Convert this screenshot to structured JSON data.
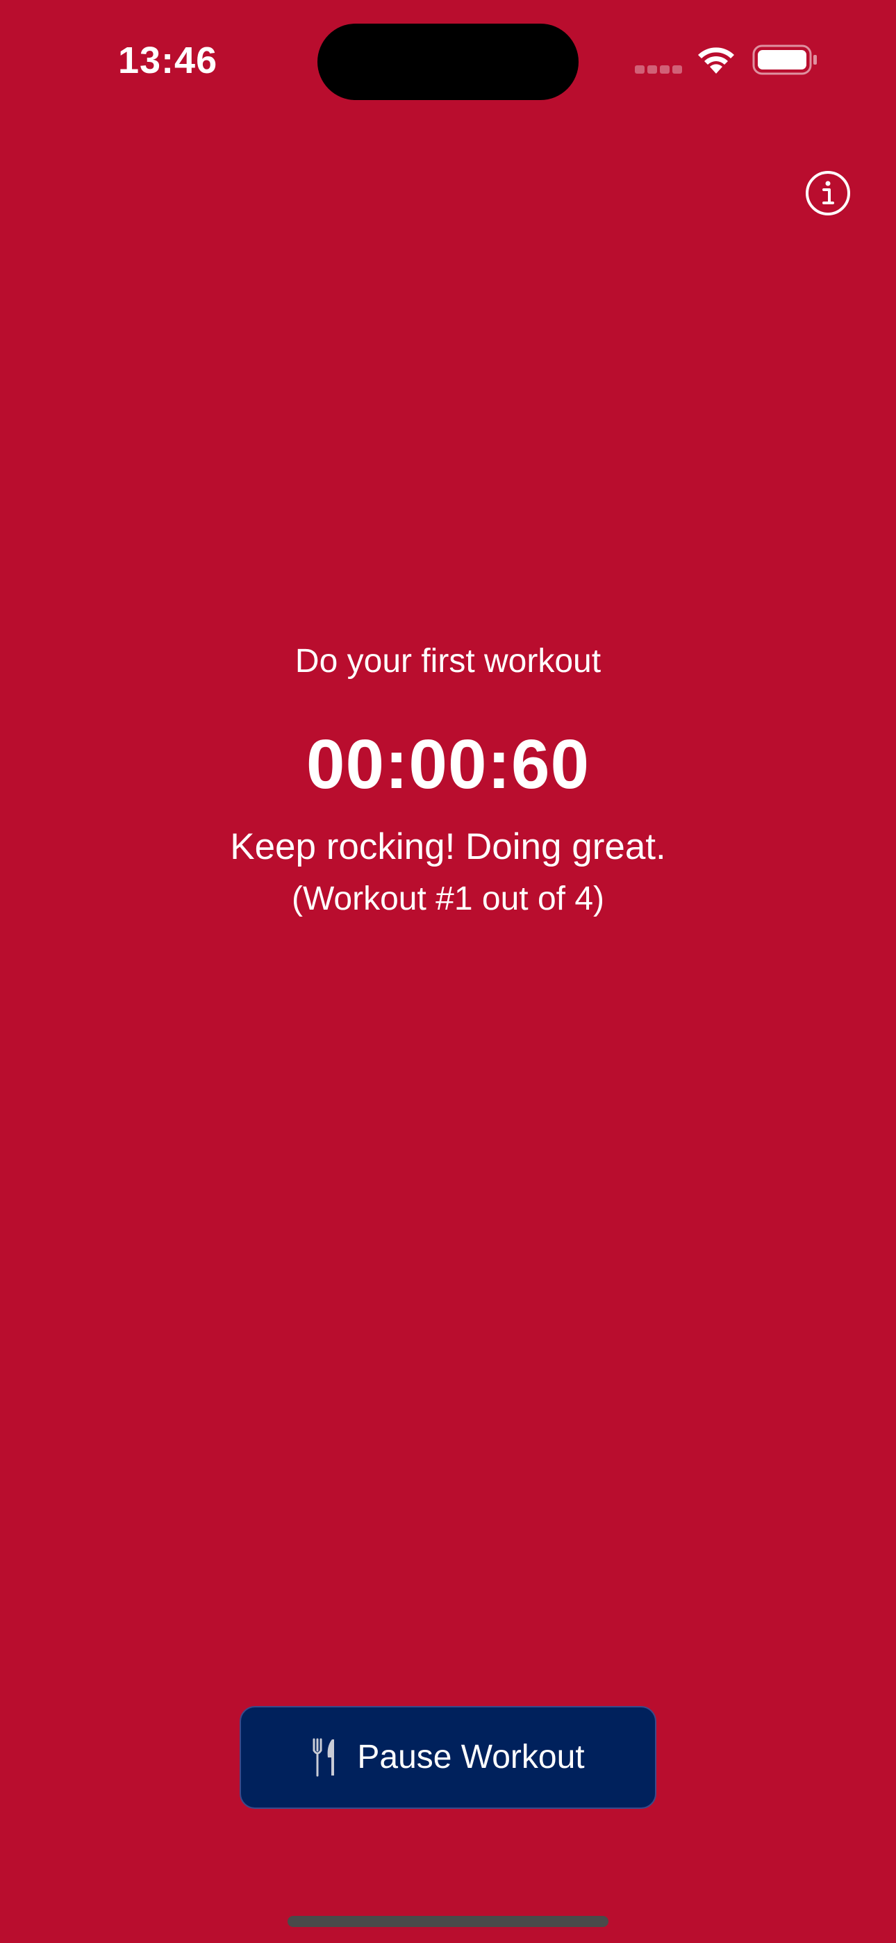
{
  "status_bar": {
    "time": "13:46"
  },
  "workout": {
    "prompt": "Do your first workout",
    "timer": "00:00:60",
    "message": "Keep rocking! Doing great.",
    "progress": "(Workout #1 out of 4)"
  },
  "actions": {
    "pause_label": "Pause Workout",
    "pause_icon": "fork-knife-icon",
    "info_icon": "info-icon"
  },
  "colors": {
    "background": "#b90d2e",
    "button": "#00215c",
    "text": "#ffffff"
  }
}
